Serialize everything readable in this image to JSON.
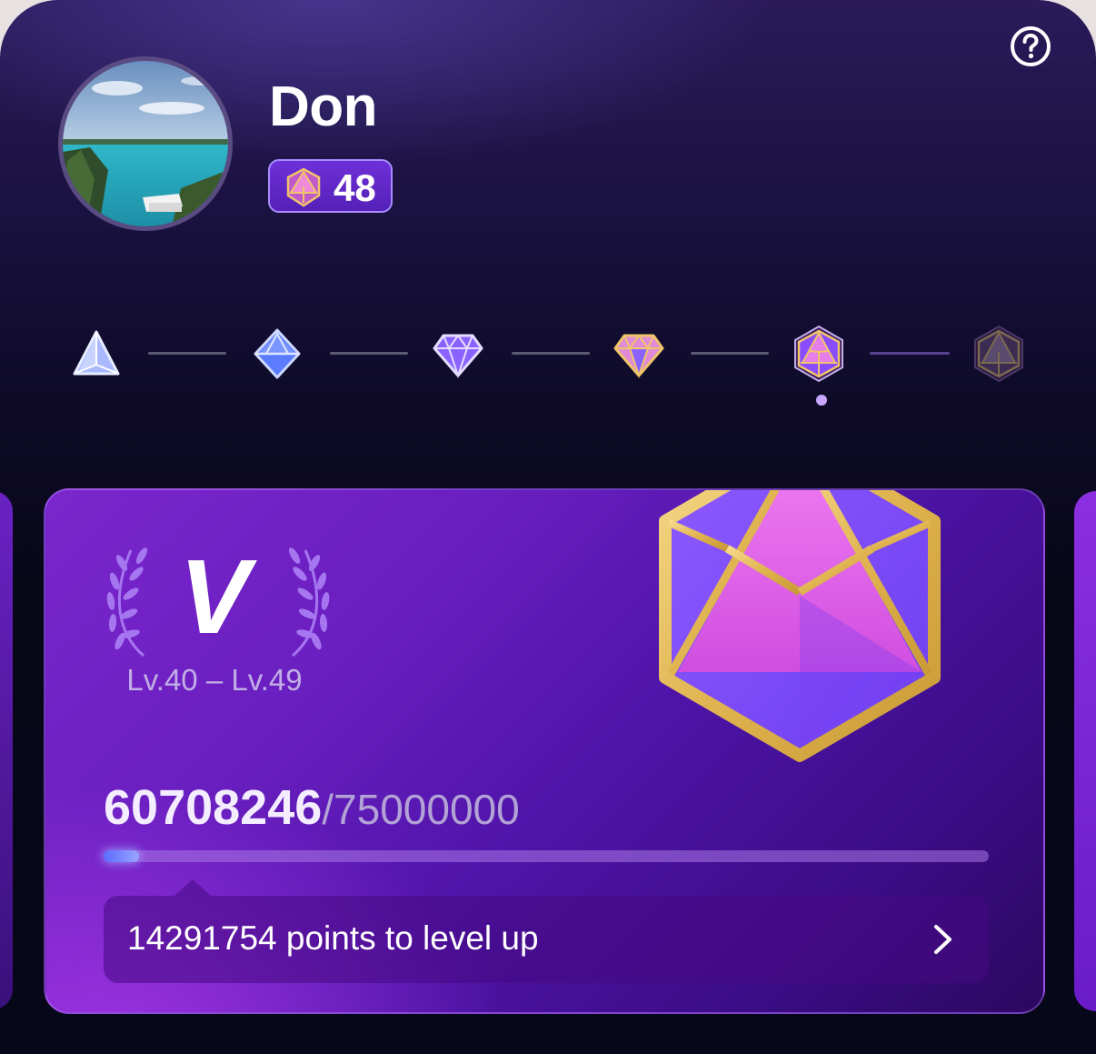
{
  "profile": {
    "name": "Don",
    "level": "48",
    "avatar_icon": "beach-photo"
  },
  "header": {
    "help_icon": "question-circle-icon"
  },
  "tiers": [
    {
      "name": "tier-1-icon",
      "shape": "triangle",
      "color": "#a9b8ff",
      "state": "unlocked"
    },
    {
      "name": "tier-2-icon",
      "shape": "diamond",
      "color": "#5b7cff",
      "state": "unlocked"
    },
    {
      "name": "tier-3-icon",
      "shape": "gem",
      "color": "#8a63ff",
      "state": "unlocked"
    },
    {
      "name": "tier-4-icon",
      "shape": "gem",
      "color": "#e08ad8",
      "state": "unlocked"
    },
    {
      "name": "tier-5-icon",
      "shape": "hex-gem",
      "color": "#d85ce0",
      "state": "current"
    },
    {
      "name": "tier-6-icon",
      "shape": "hex-gem",
      "color": "#5a4a6e",
      "state": "locked"
    }
  ],
  "card": {
    "tier_numeral": "V",
    "level_range": "Lv.40 – Lv.49",
    "points_current": "60708246",
    "points_separator": "/",
    "points_total": "75000000",
    "progress_fraction": 0.04,
    "tip_text": "14291754 points to level up",
    "tip_icon": "chevron-right-icon"
  },
  "colors": {
    "accent": "#7a26cc",
    "gold": "#e6c064"
  }
}
